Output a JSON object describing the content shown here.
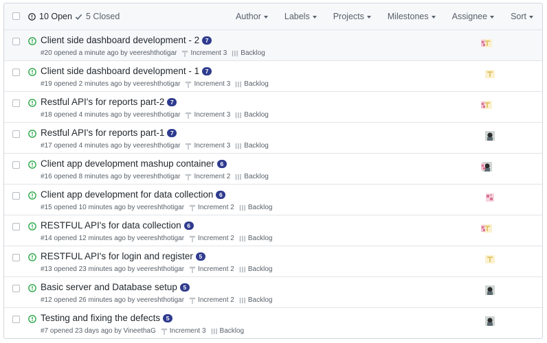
{
  "header": {
    "open_label": "10 Open",
    "closed_label": "5 Closed",
    "filters": [
      "Author",
      "Labels",
      "Projects",
      "Milestones",
      "Assignee",
      "Sort"
    ]
  },
  "issues": [
    {
      "title": "Client side dashboard development - 2",
      "comments": "7",
      "meta": "#20 opened a minute ago by veereshthotigar",
      "milestone": "Increment 3",
      "project": "Backlog",
      "avatar": "pink-yellow"
    },
    {
      "title": "Client side dashboard development - 1",
      "comments": "7",
      "meta": "#19 opened 2 minutes ago by veereshthotigar",
      "milestone": "Increment 3",
      "project": "Backlog",
      "avatar": "yellow"
    },
    {
      "title": "Restful API's for reports part-2",
      "comments": "7",
      "meta": "#18 opened 4 minutes ago by veereshthotigar",
      "milestone": "Increment 3",
      "project": "Backlog",
      "avatar": "pink-yellow"
    },
    {
      "title": "Restful API's for reports part-1",
      "comments": "7",
      "meta": "#17 opened 4 minutes ago by veereshthotigar",
      "milestone": "Increment 3",
      "project": "Backlog",
      "avatar": "photo"
    },
    {
      "title": "Client app development mashup container",
      "comments": "6",
      "meta": "#16 opened 8 minutes ago by veereshthotigar",
      "milestone": "Increment 2",
      "project": "Backlog",
      "avatar": "pink-photo"
    },
    {
      "title": "Client app development for data collection",
      "comments": "6",
      "meta": "#15 opened 10 minutes ago by veereshthotigar",
      "milestone": "Increment 2",
      "project": "Backlog",
      "avatar": "pink"
    },
    {
      "title": "RESTFUL API's for data collection",
      "comments": "6",
      "meta": "#14 opened 12 minutes ago by veereshthotigar",
      "milestone": "Increment 2",
      "project": "Backlog",
      "avatar": "pink-yellow"
    },
    {
      "title": "RESTFUL API's for login and register",
      "comments": "5",
      "meta": "#13 opened 23 minutes ago by veereshthotigar",
      "milestone": "Increment 2",
      "project": "Backlog",
      "avatar": "yellow"
    },
    {
      "title": "Basic server and Database setup",
      "comments": "5",
      "meta": "#12 opened 26 minutes ago by veereshthotigar",
      "milestone": "Increment 2",
      "project": "Backlog",
      "avatar": "photo"
    },
    {
      "title": "Testing and fixing the defects",
      "comments": "5",
      "meta": "#7 opened 23 days ago by VineethaG",
      "milestone": "Increment 3",
      "project": "Backlog",
      "avatar": "photo"
    }
  ],
  "colors": {
    "open_icon": "#28a745",
    "comment_badge": "#2f3b8f",
    "header_bg": "#f6f8fa",
    "border": "#e1e4e8"
  },
  "icons": [
    "issue-opened-icon",
    "check-icon",
    "milestone-icon",
    "project-icon",
    "caret-down-icon"
  ]
}
